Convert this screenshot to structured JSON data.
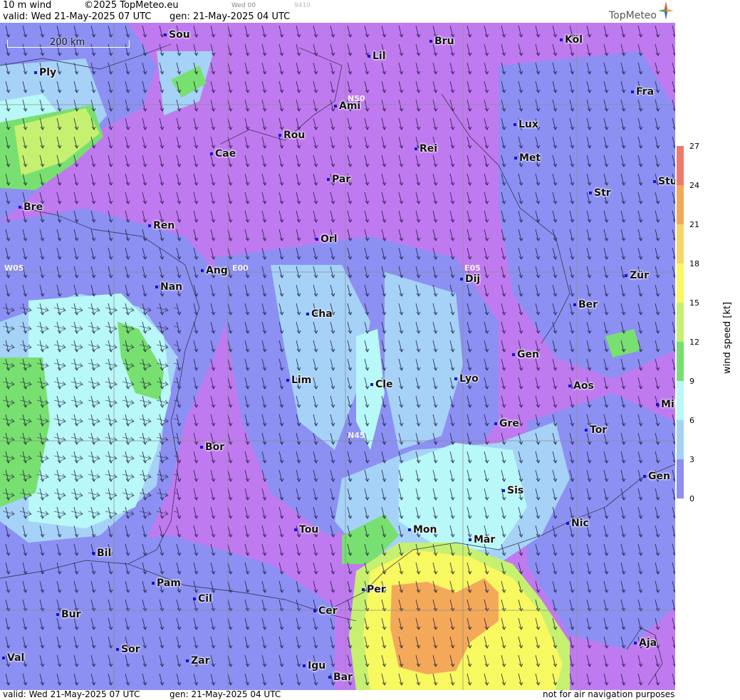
{
  "header": {
    "product": "10 m wind",
    "copyright": "©2025 TopMeteo.eu",
    "small_label": "Wed 00",
    "small_code": "9410",
    "valid": "valid:  Wed  21-May-2025  07 UTC",
    "gen": "gen: 21-May-2025 04 UTC",
    "logo": "TopMeteo"
  },
  "footer": {
    "valid": "valid:  Wed  21-May-2025  07 UTC",
    "gen": "gen: 21-May-2025 04 UTC",
    "disclaimer": "not for air navigation purposes"
  },
  "scale": {
    "label": "200 km"
  },
  "grid_labels": [
    "N50",
    "N45",
    "W05",
    "E00",
    "E05"
  ],
  "cities": [
    "Sou",
    "Bru",
    "Köl",
    "Ply",
    "Lil",
    "Fra",
    "Ami",
    "Lux",
    "Rou",
    "Cae",
    "Rei",
    "Met",
    "Par",
    "Stu",
    "Bre",
    "Str",
    "Ren",
    "Orl",
    "Ang",
    "Dij",
    "Zür",
    "Nan",
    "Ber",
    "Cha",
    "Gen",
    "Lim",
    "Cle",
    "Lyo",
    "Aos",
    "Mil",
    "Gre",
    "Tor",
    "Bor",
    "Sis",
    "Gen",
    "Tou",
    "Mon",
    "Mar",
    "Nic",
    "Bil",
    "Pam",
    "Cil",
    "Per",
    "Cer",
    "Bur",
    "Aja",
    "Sor",
    "Val",
    "Zar",
    "Igu",
    "Bar"
  ],
  "legend": {
    "title": "wind speed [kt]",
    "ticks": [
      "27",
      "24",
      "21",
      "18",
      "15",
      "12",
      "9",
      "6",
      "3",
      "0"
    ],
    "colors": [
      "#f07a6a",
      "#f4a95a",
      "#f6d668",
      "#f8f860",
      "#c6f070",
      "#78e070",
      "#b8f8f8",
      "#a6d2f8",
      "#8c90f2",
      "#c07af0"
    ]
  }
}
